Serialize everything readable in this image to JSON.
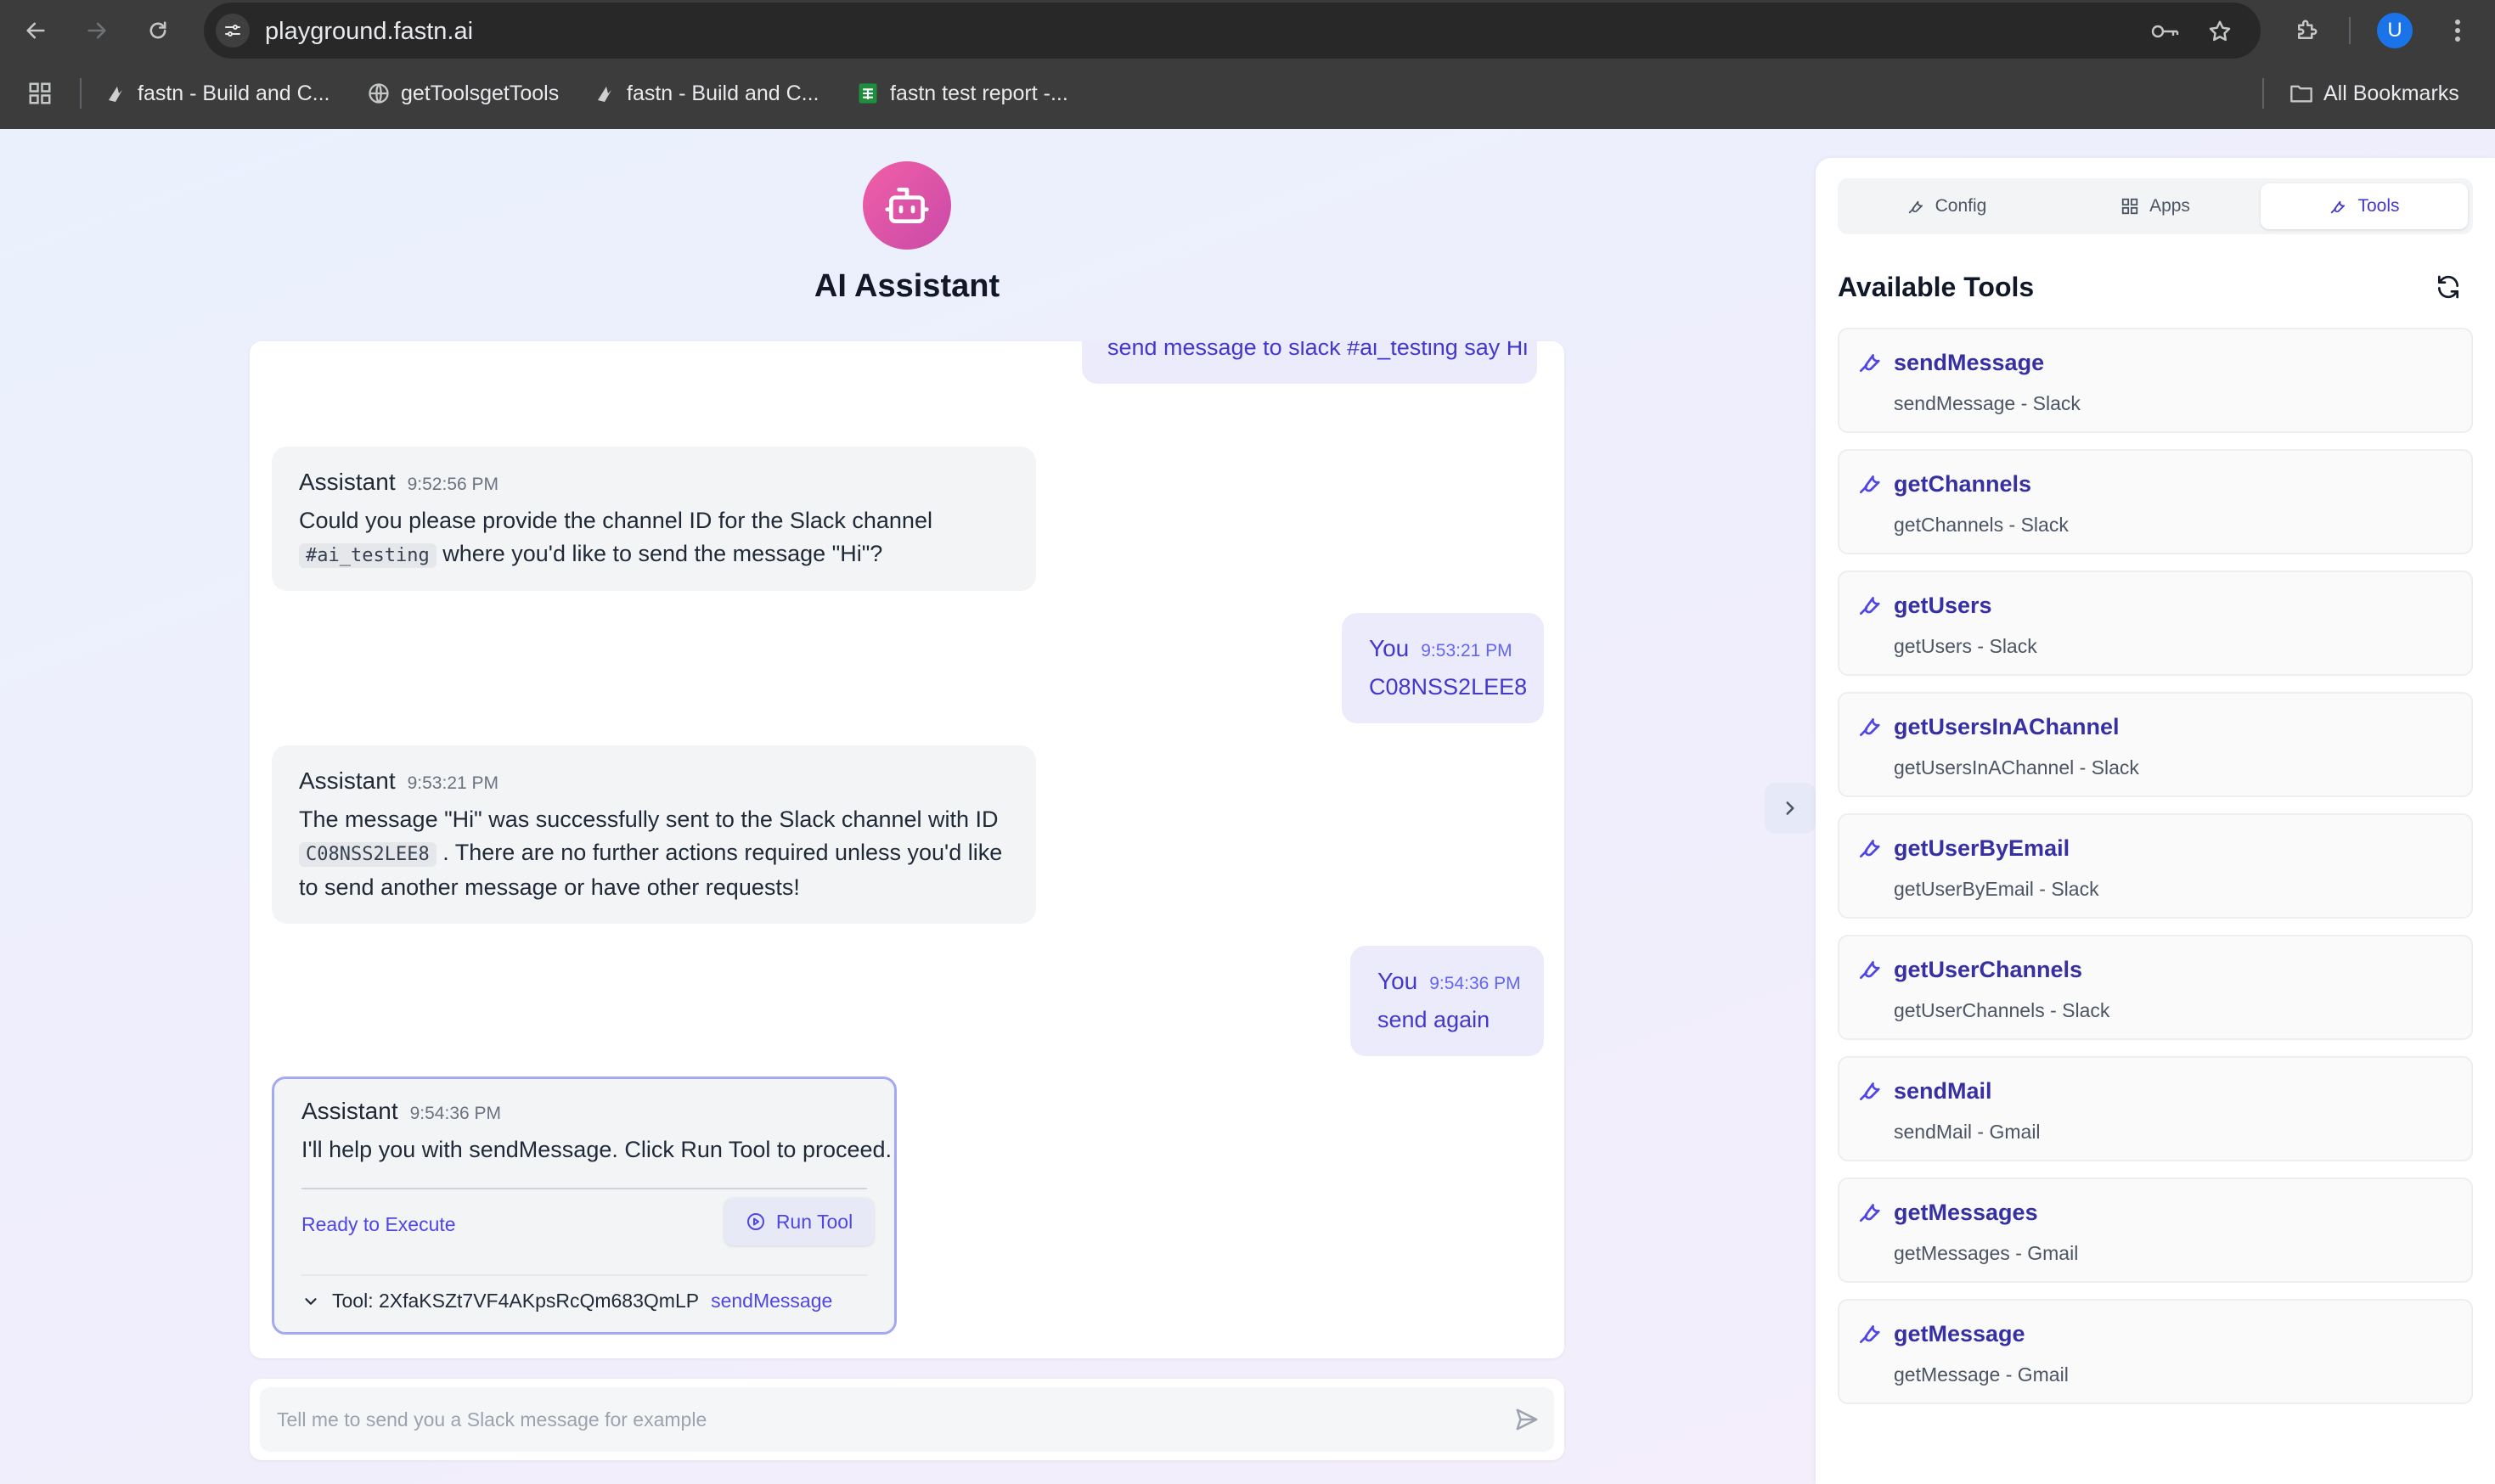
{
  "browser": {
    "url": "playground.fastn.ai",
    "bookmarks": [
      {
        "label": "fastn - Build and C..."
      },
      {
        "label": "getToolsgetTools"
      },
      {
        "label": "fastn - Build and C..."
      },
      {
        "label": "fastn test report -..."
      }
    ],
    "all_bookmarks_label": "All Bookmarks",
    "avatar_letter": "U"
  },
  "header": {
    "title": "AI Assistant"
  },
  "chat": {
    "partial_user_message": "send message to slack #ai_testing say Hi",
    "messages": [
      {
        "role": "Assistant",
        "time": "9:52:56 PM",
        "text_before": "Could you please provide the channel ID for the Slack channel",
        "code": "#ai_testing",
        "text_after": "where you'd like to send the message \"Hi\"?"
      },
      {
        "role": "You",
        "time": "9:53:21 PM",
        "text": "C08NSS2LEE8"
      },
      {
        "role": "Assistant",
        "time": "9:53:21 PM",
        "text_before": "The message \"Hi\" was successfully sent to the Slack channel with ID",
        "code": "C08NSS2LEE8",
        "text_after": ". There are no further actions required unless you'd like to send another message or have other requests!"
      },
      {
        "role": "You",
        "time": "9:54:36 PM",
        "text": "send again"
      },
      {
        "role": "Assistant",
        "time": "9:54:36 PM",
        "text": "I'll help you with sendMessage. Click Run Tool to proceed.",
        "status": "Ready to Execute",
        "run_label": "Run Tool",
        "tool_prefix": "Tool: 2XfaKSZt7VF4AKpsRcQm683QmLP",
        "tool_name": "sendMessage"
      }
    ]
  },
  "composer": {
    "placeholder": "Tell me to send you a Slack message for example"
  },
  "panel": {
    "tabs": [
      {
        "label": "Config",
        "active": false
      },
      {
        "label": "Apps",
        "active": false
      },
      {
        "label": "Tools",
        "active": true
      }
    ],
    "title": "Available Tools",
    "tools": [
      {
        "name": "sendMessage",
        "desc": "sendMessage - Slack"
      },
      {
        "name": "getChannels",
        "desc": "getChannels - Slack"
      },
      {
        "name": "getUsers",
        "desc": "getUsers - Slack"
      },
      {
        "name": "getUsersInAChannel",
        "desc": "getUsersInAChannel - Slack"
      },
      {
        "name": "getUserByEmail",
        "desc": "getUserByEmail - Slack"
      },
      {
        "name": "getUserChannels",
        "desc": "getUserChannels - Slack"
      },
      {
        "name": "sendMail",
        "desc": "sendMail - Gmail"
      },
      {
        "name": "getMessages",
        "desc": "getMessages - Gmail"
      },
      {
        "name": "getMessage",
        "desc": "getMessage - Gmail"
      }
    ]
  },
  "colors": {
    "accent": "#4f46e5",
    "tool_name": "#3730a3",
    "avatar_gradient_start": "#f15fa6",
    "avatar_gradient_end": "#c94aa9",
    "trash": "#dc2626"
  },
  "icons": {
    "back": "arrow-left-icon",
    "forward": "arrow-right-icon",
    "reload": "reload-icon",
    "site_settings": "tune-icon",
    "password": "key-icon",
    "star": "star-icon",
    "extensions": "puzzle-icon",
    "menu": "kebab-menu-icon",
    "apps": "apps-grid-icon",
    "folder": "folder-icon",
    "bot": "robot-icon",
    "trash": "trash-icon",
    "run": "play-circle-icon",
    "chevron": "chevron-down-icon",
    "send": "send-icon",
    "collapse": "chevron-right-icon",
    "config": "wrench-icon",
    "apps_tab": "grid-icon",
    "tools": "wrench-icon",
    "refresh": "refresh-icon"
  }
}
